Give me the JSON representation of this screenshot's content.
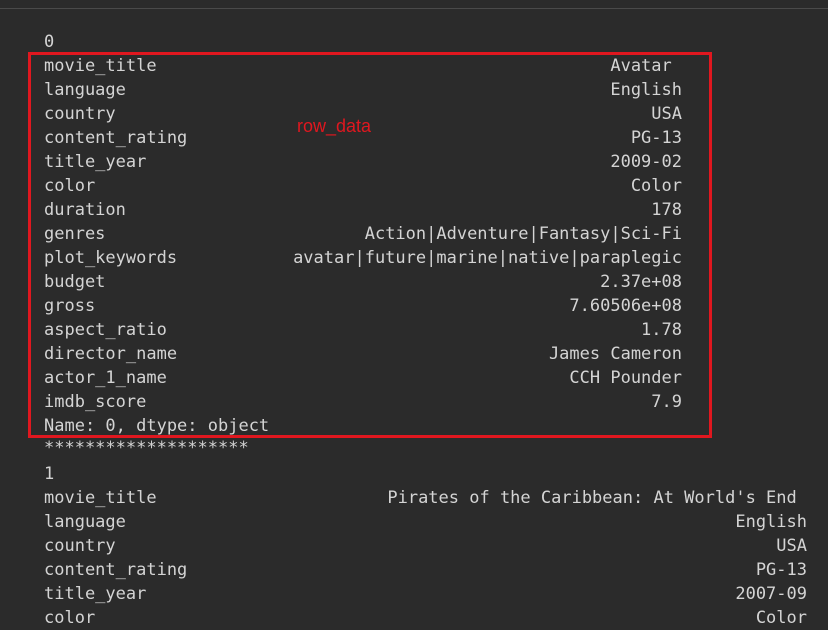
{
  "annotation": {
    "label": "row_data",
    "color": "#e0171f"
  },
  "records": [
    {
      "index": "0",
      "fields": [
        {
          "key": "movie_title",
          "value": "Avatar "
        },
        {
          "key": "language",
          "value": "English"
        },
        {
          "key": "country",
          "value": "USA"
        },
        {
          "key": "content_rating",
          "value": "PG-13"
        },
        {
          "key": "title_year",
          "value": "2009-02"
        },
        {
          "key": "color",
          "value": "Color"
        },
        {
          "key": "duration",
          "value": "178"
        },
        {
          "key": "genres",
          "value": "Action|Adventure|Fantasy|Sci-Fi"
        },
        {
          "key": "plot_keywords",
          "value": "avatar|future|marine|native|paraplegic"
        },
        {
          "key": "budget",
          "value": "2.37e+08"
        },
        {
          "key": "gross",
          "value": "7.60506e+08"
        },
        {
          "key": "aspect_ratio",
          "value": "1.78"
        },
        {
          "key": "director_name",
          "value": "James Cameron"
        },
        {
          "key": "actor_1_name",
          "value": "CCH Pounder"
        },
        {
          "key": "imdb_score",
          "value": "7.9"
        }
      ],
      "footer": "Name: 0, dtype: object"
    },
    {
      "index": "1",
      "fields": [
        {
          "key": "movie_title",
          "value": "Pirates of the Caribbean: At World's End "
        },
        {
          "key": "language",
          "value": "English"
        },
        {
          "key": "country",
          "value": "USA"
        },
        {
          "key": "content_rating",
          "value": "PG-13"
        },
        {
          "key": "title_year",
          "value": "2007-09"
        },
        {
          "key": "color",
          "value": "Color"
        }
      ]
    }
  ],
  "separator": "********************"
}
